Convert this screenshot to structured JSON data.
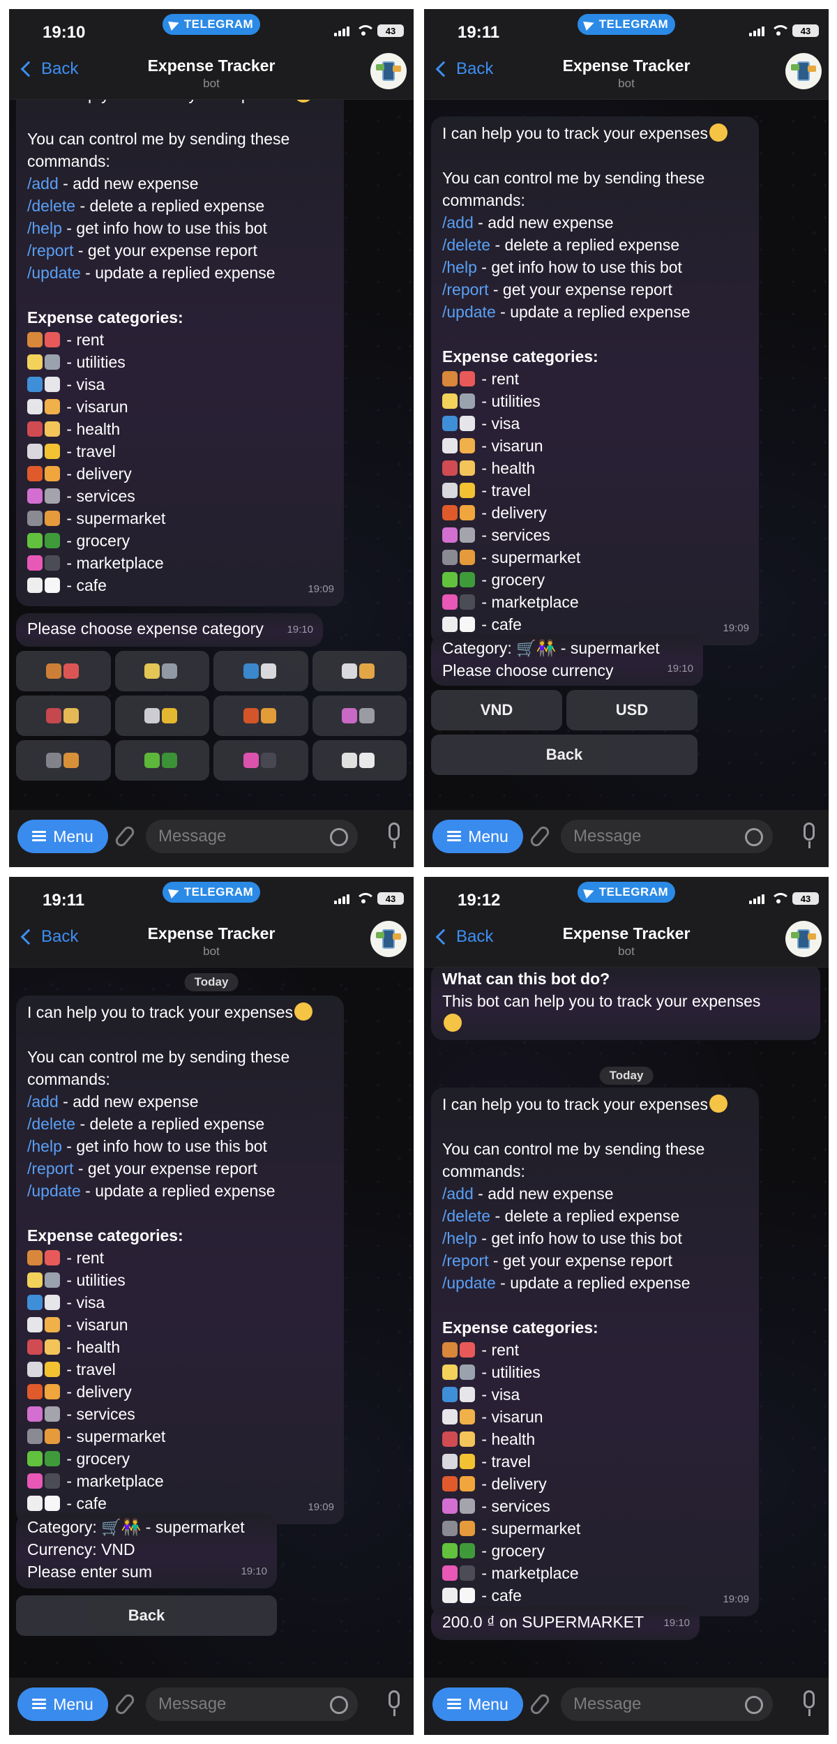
{
  "common": {
    "telegram_label": "TELEGRAM",
    "battery": "43",
    "back_label": "Back",
    "title": "Expense Tracker",
    "subtitle": "bot",
    "menu_label": "Menu",
    "message_placeholder": "Message"
  },
  "screens": [
    {
      "time": "19:10"
    },
    {
      "time": "19:11"
    },
    {
      "time": "19:11"
    },
    {
      "time": "19:12"
    }
  ],
  "intro": {
    "line1": "I can help you to track your expenses",
    "line2": "You can control me by sending these",
    "line3": "commands:",
    "commands": [
      {
        "cmd": "/add",
        "desc": " - add new expense"
      },
      {
        "cmd": "/delete",
        "desc": " - delete a replied expense"
      },
      {
        "cmd": "/help",
        "desc": " - get info how to use this bot"
      },
      {
        "cmd": "/report",
        "desc": " - get your expense report"
      },
      {
        "cmd": "/update",
        "desc": " - update a replied expense"
      }
    ],
    "categories_heading": "Expense categories:",
    "categories": [
      {
        "label": "- rent",
        "c1": "#d9873a",
        "c2": "#e85a5a"
      },
      {
        "label": "- utilities",
        "c1": "#f2d25a",
        "c2": "#9aa3ad"
      },
      {
        "label": "- visa",
        "c1": "#3e8fd8",
        "c2": "#e6e6ea"
      },
      {
        "label": "- visarun",
        "c1": "#e6e6ea",
        "c2": "#f0b04a"
      },
      {
        "label": "- health",
        "c1": "#d04c52",
        "c2": "#f3c45a"
      },
      {
        "label": "- travel",
        "c1": "#d8d8de",
        "c2": "#f2c232"
      },
      {
        "label": "- delivery",
        "c1": "#e05a2b",
        "c2": "#f0a63c"
      },
      {
        "label": "- services",
        "c1": "#d36fd0",
        "c2": "#a4a4ad"
      },
      {
        "label": "- supermarket",
        "c1": "#8a8a93",
        "c2": "#e59a3c"
      },
      {
        "label": "- grocery",
        "c1": "#62c23e",
        "c2": "#3f9b3a"
      },
      {
        "label": "- marketplace",
        "c1": "#e858b6",
        "c2": "#4c4c56"
      },
      {
        "label": "- cafe",
        "c1": "#eeeeee",
        "c2": "#f7f7f7"
      }
    ],
    "time": "19:09"
  },
  "s1": {
    "prompt": "Please choose expense category",
    "prompt_time": "19:10"
  },
  "s2": {
    "line1": "Category: 🛒👫 - supermarket",
    "line2": "Please choose currency",
    "time": "19:10",
    "btn_vnd": "VND",
    "btn_usd": "USD",
    "btn_back": "Back"
  },
  "s3": {
    "date": "Today",
    "line1": "Category: 🛒👫 - supermarket",
    "line2": "Currency: VND",
    "line3": "Please enter sum",
    "time": "19:10",
    "btn_back": "Back"
  },
  "s4": {
    "about_title": "What can this bot do?",
    "about_text": "This bot can help you to track your expenses",
    "date": "Today",
    "result": "200.0 ₫ on SUPERMARKET",
    "result_time": "19:10"
  }
}
